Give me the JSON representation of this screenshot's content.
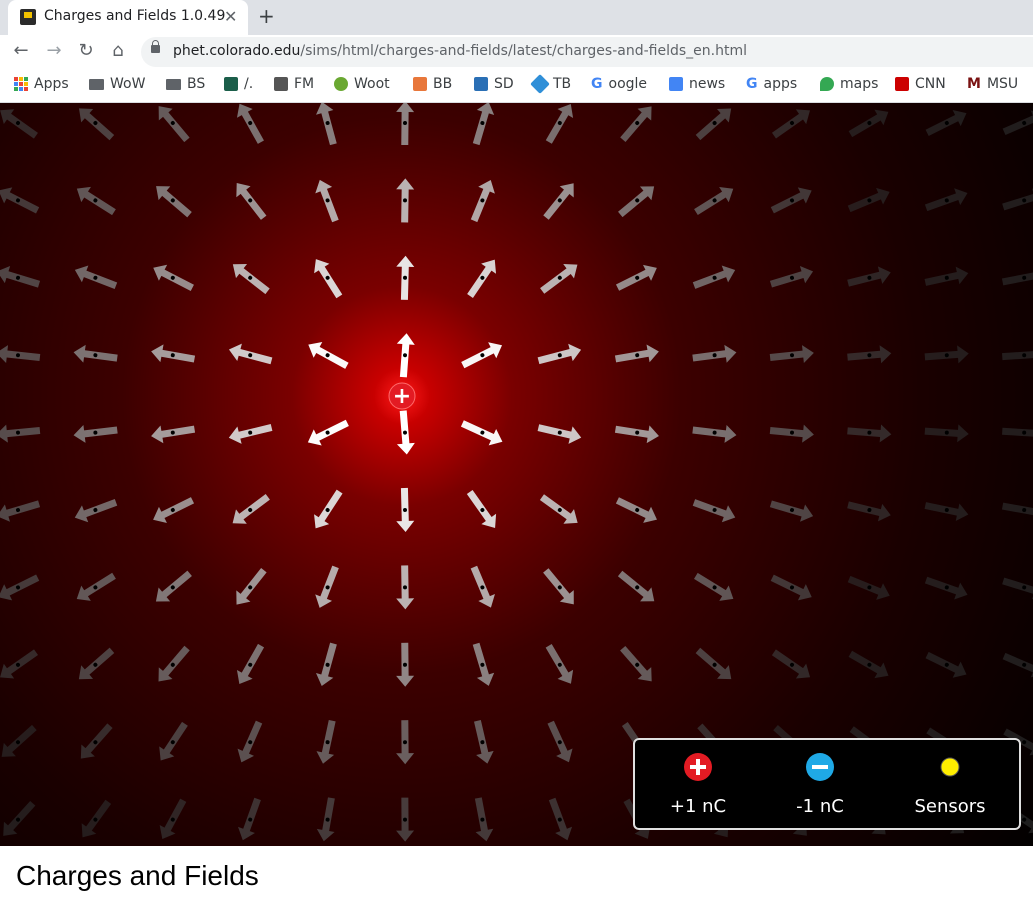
{
  "browser": {
    "tab_title": "Charges and Fields 1.0.49",
    "tab_close": "✕",
    "new_tab": "+",
    "url_host": "phet.colorado.edu",
    "url_path": "/sims/html/charges-and-fields/latest/charges-and-fields_en.html"
  },
  "bookmarks": [
    {
      "label": "Apps"
    },
    {
      "label": "WoW"
    },
    {
      "label": "BS"
    },
    {
      "label": "/."
    },
    {
      "label": "FM"
    },
    {
      "label": "Woot"
    },
    {
      "label": "BB"
    },
    {
      "label": "SD"
    },
    {
      "label": "TB"
    },
    {
      "label": "oogle"
    },
    {
      "label": "news"
    },
    {
      "label": "apps"
    },
    {
      "label": "maps"
    },
    {
      "label": "CNN"
    },
    {
      "label": "MSU"
    }
  ],
  "sim": {
    "charge_symbol": "+",
    "tools": [
      {
        "label": "+1 nC",
        "color": "#e31b23",
        "symbol": "+"
      },
      {
        "label": "-1 nC",
        "color": "#1fa9e6",
        "symbol": "−"
      },
      {
        "label": "Sensors",
        "color": "#ffee00",
        "symbol": ""
      }
    ]
  },
  "page_title": "Charges and Fields"
}
